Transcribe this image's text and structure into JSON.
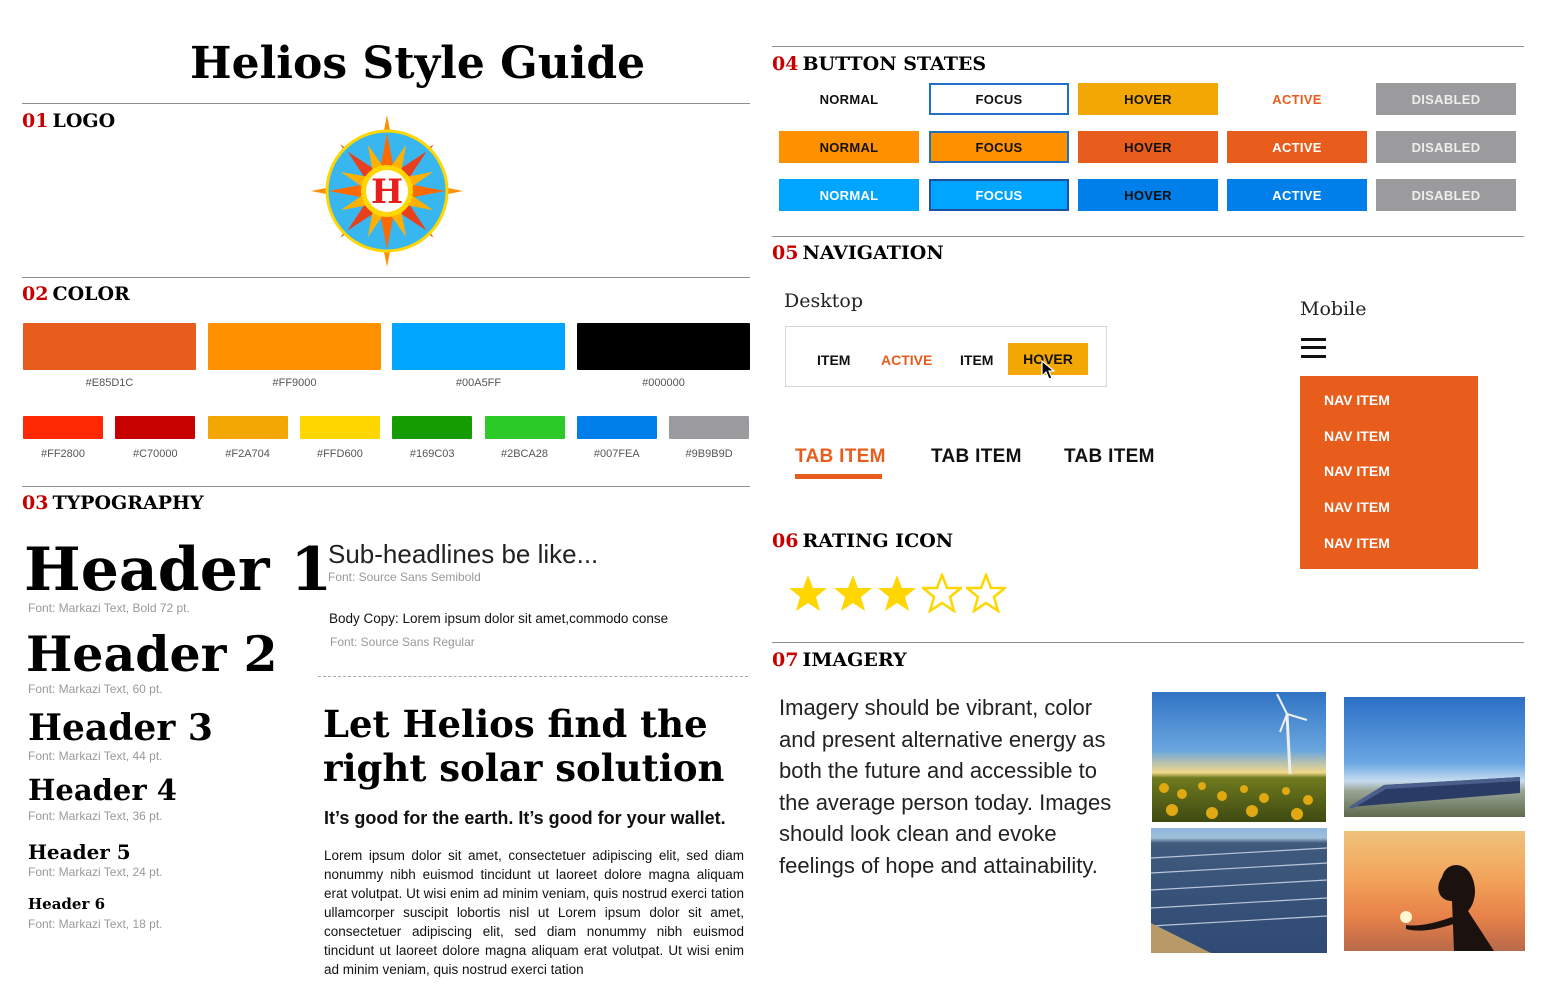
{
  "title": "Helios Style Guide",
  "sections": {
    "logo": {
      "num": "01",
      "label": "LOGO",
      "letter": "H"
    },
    "color": {
      "num": "02",
      "label": "COLOR"
    },
    "typography": {
      "num": "03",
      "label": "TYPOGRAPHY"
    },
    "buttons": {
      "num": "04",
      "label": "BUTTON STATES"
    },
    "navigation": {
      "num": "05",
      "label": "NAVIGATION"
    },
    "rating": {
      "num": "06",
      "label": "RATING ICON"
    },
    "imagery": {
      "num": "07",
      "label": "IMAGERY"
    }
  },
  "colors": {
    "primary": [
      {
        "hex": "#E85D1C",
        "label": "#E85D1C"
      },
      {
        "hex": "#FF9000",
        "label": "#FF9000"
      },
      {
        "hex": "#00A5FF",
        "label": "#00A5FF"
      },
      {
        "hex": "#000000",
        "label": "#000000"
      }
    ],
    "secondary": [
      {
        "hex": "#FF2800",
        "label": "#FF2800"
      },
      {
        "hex": "#C70000",
        "label": "#C70000"
      },
      {
        "hex": "#F2A704",
        "label": "#F2A704"
      },
      {
        "hex": "#FFD600",
        "label": "#FFD600"
      },
      {
        "hex": "#169C03",
        "label": "#169C03"
      },
      {
        "hex": "#2BCA28",
        "label": "#2BCA28"
      },
      {
        "hex": "#007FEA",
        "label": "#007FEA"
      },
      {
        "hex": "#9B9B9D",
        "label": "#9B9B9D"
      }
    ]
  },
  "typography": {
    "h1": {
      "text": "Header 1",
      "note": "Font: Markazi Text, Bold 72 pt."
    },
    "h2": {
      "text": "Header 2",
      "note": "Font: Markazi Text, 60 pt."
    },
    "h3": {
      "text": "Header 3",
      "note": "Font: Markazi Text, 44 pt."
    },
    "h4": {
      "text": "Header 4",
      "note": "Font: Markazi Text, 36 pt."
    },
    "h5": {
      "text": "Header 5",
      "note": "Font: Markazi Text, 24 pt."
    },
    "h6": {
      "text": "Header 6",
      "note": "Font: Markazi Text, 18 pt."
    },
    "subhead": {
      "text": "Sub-headlines be like...",
      "note": "Font: Source Sans Semibold"
    },
    "body": {
      "text": "Body Copy: Lorem ipsum dolor sit amet,commodo conse",
      "note": "Font: Source Sans Regular"
    },
    "sample_headline": "Let Helios find the right solar solution",
    "sample_sub": "It’s good for the earth. It’s good for your wallet.",
    "sample_body": "Lorem ipsum dolor sit amet, consectetuer adipiscing elit, sed diam nonummy nibh euismod tincidunt ut laoreet dolore magna aliquam erat volutpat. Ut wisi enim ad minim veniam, quis nostrud exerci tation ullamcorper suscipit lobortis nisl ut Lorem ipsum dolor sit amet, consectetuer adipiscing elit, sed diam nonummy nibh euismod tincidunt ut laoreet dolore magna aliquam erat volutpat. Ut wisi enim ad minim veniam, quis nostrud exerci tation"
  },
  "buttons": {
    "labels": [
      "NORMAL",
      "FOCUS",
      "HOVER",
      "ACTIVE",
      "DISABLED"
    ],
    "rows": [
      {
        "style": "text",
        "accent": "#E85D1C"
      },
      {
        "style": "orange",
        "accent": "#FF9000"
      },
      {
        "style": "blue",
        "accent": "#00A5FF"
      }
    ]
  },
  "navigation": {
    "desktop_label": "Desktop",
    "desktop_items": [
      "ITEM",
      "ACTIVE",
      "ITEM",
      "HOVER"
    ],
    "mobile_label": "Mobile",
    "mobile_items": [
      "NAV ITEM",
      "NAV ITEM",
      "NAV ITEM",
      "NAV ITEM",
      "NAV ITEM"
    ],
    "tabs": [
      "TAB ITEM",
      "TAB ITEM",
      "TAB ITEM"
    ],
    "icons": [
      "hamburger-icon",
      "cursor-icon"
    ]
  },
  "rating": {
    "value": 3,
    "max": 5,
    "color": "#FFD600"
  },
  "imagery": {
    "text": "Imagery should be vibrant, color and present alternative energy as both the future and accessible to the average person today. Images should look clean and evoke feelings of hope and attainability."
  }
}
